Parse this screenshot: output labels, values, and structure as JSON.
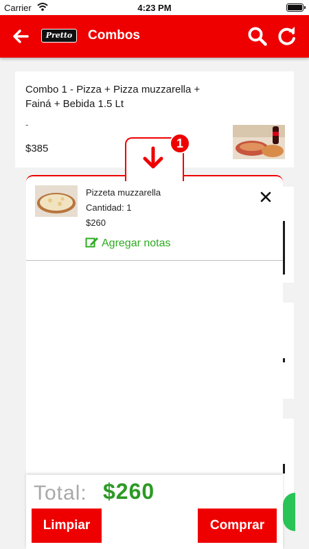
{
  "status_bar": {
    "carrier": "Carrier",
    "time": "4:23 PM"
  },
  "header": {
    "logo_text": "Pretto",
    "title": "Combos"
  },
  "products": [
    {
      "name": "Combo 1 - Pizza + Pizza muzzarella + Fainá + Bebida 1.5 Lt",
      "description": "-",
      "price": "$385"
    }
  ],
  "cart": {
    "badge_count": "1",
    "items": [
      {
        "name": "Pizzeta muzzarella",
        "quantity_label": "Cantidad: 1",
        "price": "$260",
        "add_notes_label": "Agregar notas"
      }
    ],
    "total_label": "Total:",
    "total_value": "$260",
    "clear_label": "Limpiar",
    "buy_label": "Comprar"
  },
  "colors": {
    "brand_red": "#ee0000",
    "notes_green": "#2bab1f",
    "total_green": "#2b9a23",
    "whatsapp_green": "#29c356"
  }
}
